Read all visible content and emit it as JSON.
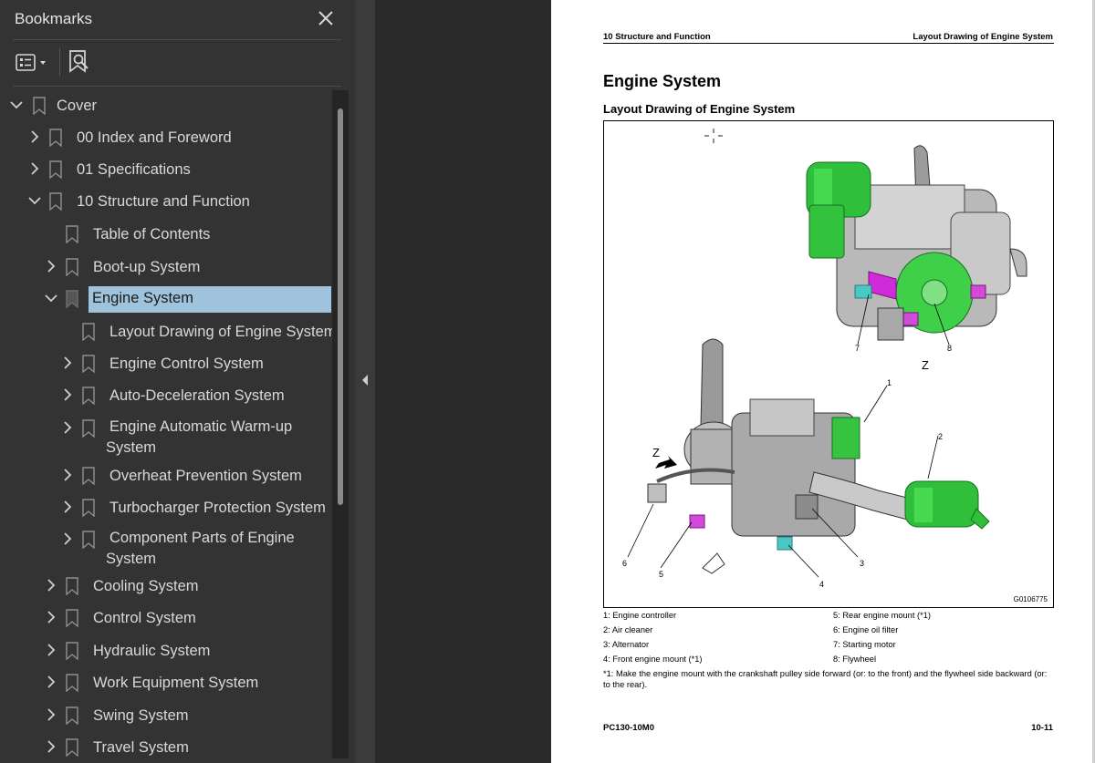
{
  "sidebar": {
    "title": "Bookmarks",
    "close_icon": "close-icon",
    "toolbar": {
      "options_icon": "list-options-icon",
      "find_icon": "find-bookmark-icon"
    },
    "items": [
      {
        "label": "Cover",
        "level": 0,
        "state": "expanded"
      },
      {
        "label": "00 Index and Foreword",
        "level": 1,
        "state": "collapsed"
      },
      {
        "label": "01 Specifications",
        "level": 1,
        "state": "collapsed"
      },
      {
        "label": "10 Structure and Function",
        "level": 1,
        "state": "expanded"
      },
      {
        "label": "Table of Contents",
        "level": 2,
        "state": "leaf"
      },
      {
        "label": "Boot-up System",
        "level": 2,
        "state": "collapsed"
      },
      {
        "label": "Engine System",
        "level": 2,
        "state": "expanded",
        "selected": true
      },
      {
        "label": "Layout Drawing of Engine System",
        "level": 3,
        "state": "leaf"
      },
      {
        "label": "Engine Control System",
        "level": 3,
        "state": "collapsed"
      },
      {
        "label": "Auto-Deceleration System",
        "level": 3,
        "state": "collapsed"
      },
      {
        "label": "Engine Automatic Warm-up System",
        "level": 3,
        "state": "collapsed"
      },
      {
        "label": "Overheat Prevention System",
        "level": 3,
        "state": "collapsed"
      },
      {
        "label": "Turbocharger Protection System",
        "level": 3,
        "state": "collapsed"
      },
      {
        "label": "Component Parts of Engine System",
        "level": 3,
        "state": "collapsed"
      },
      {
        "label": "Cooling System",
        "level": 2,
        "state": "collapsed"
      },
      {
        "label": "Control System",
        "level": 2,
        "state": "collapsed"
      },
      {
        "label": "Hydraulic System",
        "level": 2,
        "state": "collapsed"
      },
      {
        "label": "Work Equipment System",
        "level": 2,
        "state": "collapsed"
      },
      {
        "label": "Swing System",
        "level": 2,
        "state": "collapsed"
      },
      {
        "label": "Travel System",
        "level": 2,
        "state": "collapsed"
      }
    ]
  },
  "page": {
    "header_left": "10 Structure and Function",
    "header_right": "Layout Drawing of Engine System",
    "heading": "Engine System",
    "subheading": "Layout Drawing of Engine System",
    "figure_code": "G0106775",
    "callouts": [
      "1",
      "2",
      "3",
      "4",
      "5",
      "6",
      "7",
      "8"
    ],
    "view_label": "Z",
    "captions_left": [
      "1: Engine controller",
      "2: Air cleaner",
      "3: Alternator",
      "4: Front engine mount (*1)"
    ],
    "captions_right": [
      "5: Rear engine mount (*1)",
      "6: Engine oil filter",
      "7: Starting motor",
      "8: Flywheel"
    ],
    "note": "*1: Make the engine mount with the crankshaft pulley side forward (or: to the front) and the flywheel side backward (or: to the rear).",
    "footer_left": "PC130-10M0",
    "footer_right": "10-11"
  }
}
